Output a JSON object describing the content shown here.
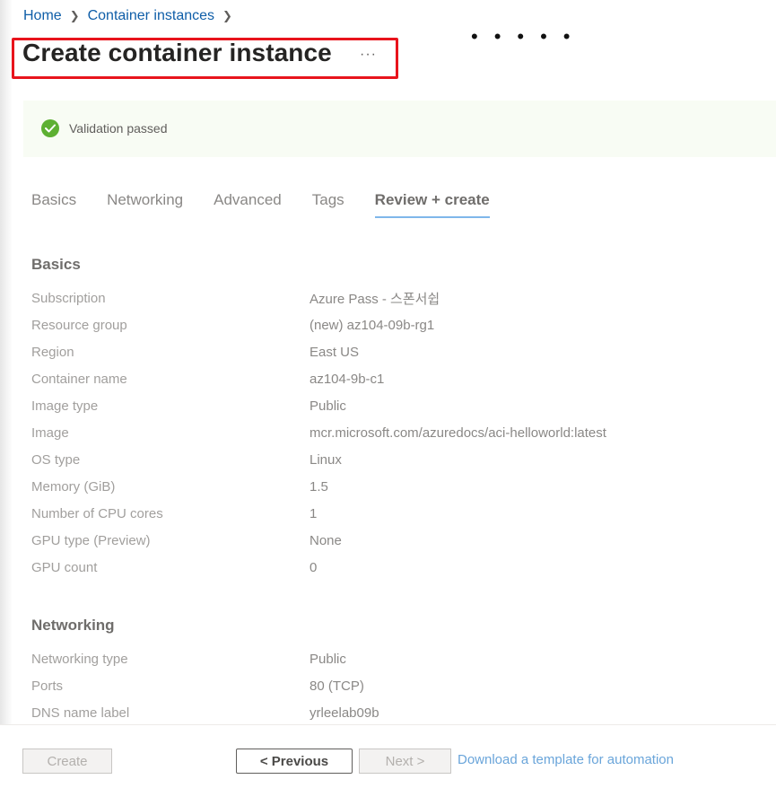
{
  "breadcrumb": {
    "items": [
      "Home",
      "Container instances"
    ]
  },
  "page": {
    "title": "Create container instance",
    "more_label": "···"
  },
  "validation": {
    "text": "Validation passed",
    "status_color": "#5db032"
  },
  "tabs": [
    {
      "label": "Basics"
    },
    {
      "label": "Networking"
    },
    {
      "label": "Advanced"
    },
    {
      "label": "Tags"
    },
    {
      "label": "Review + create",
      "active": true
    }
  ],
  "basics": {
    "heading": "Basics",
    "rows": [
      {
        "key": "Subscription",
        "value": "Azure Pass - 스폰서쉽"
      },
      {
        "key": "Resource group",
        "value": "(new) az104-09b-rg1"
      },
      {
        "key": "Region",
        "value": "East US"
      },
      {
        "key": "Container name",
        "value": "az104-9b-c1"
      },
      {
        "key": "Image type",
        "value": "Public"
      },
      {
        "key": "Image",
        "value": "mcr.microsoft.com/azuredocs/aci-helloworld:latest"
      },
      {
        "key": "OS type",
        "value": "Linux"
      },
      {
        "key": "Memory (GiB)",
        "value": "1.5"
      },
      {
        "key": "Number of CPU cores",
        "value": "1"
      },
      {
        "key": "GPU type (Preview)",
        "value": "None"
      },
      {
        "key": "GPU count",
        "value": "0"
      }
    ]
  },
  "networking": {
    "heading": "Networking",
    "rows": [
      {
        "key": "Networking type",
        "value": "Public"
      },
      {
        "key": "Ports",
        "value": "80 (TCP)"
      },
      {
        "key": "DNS name label",
        "value": "yrleelab09b"
      }
    ]
  },
  "footer": {
    "create_label": "Create",
    "previous_label": "< Previous",
    "next_label": "Next >",
    "download_link": "Download a template for automation"
  },
  "colors": {
    "link": "#0f5ea8",
    "highlight_box": "#e8141c",
    "tab_underline": "#7fb7ea"
  }
}
